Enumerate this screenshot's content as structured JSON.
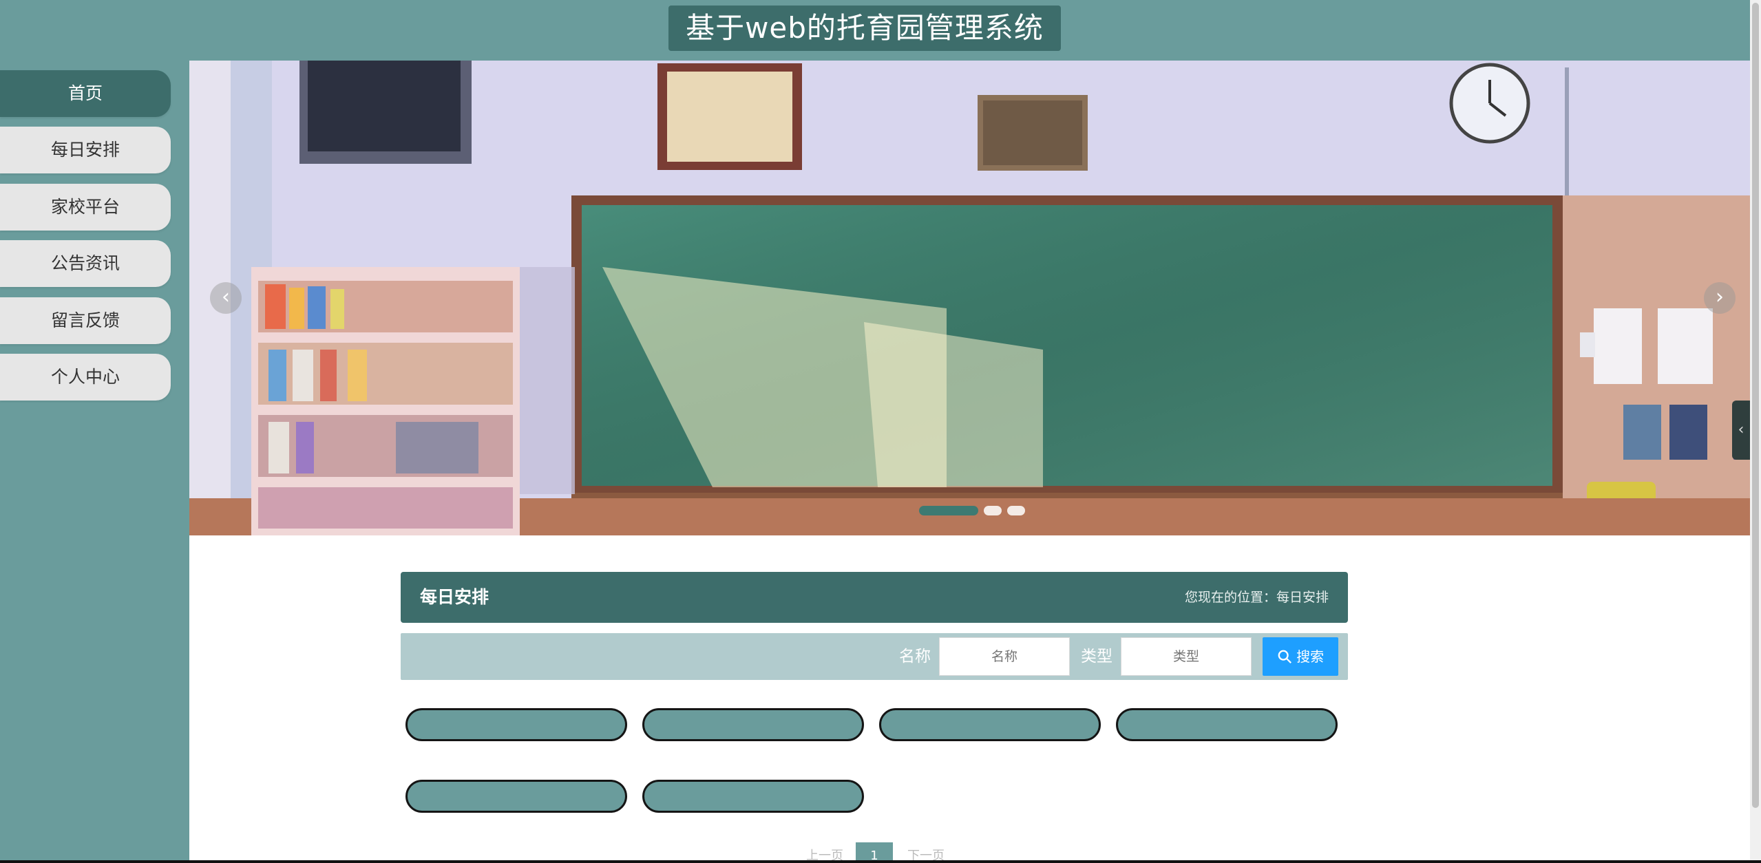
{
  "header": {
    "title": "基于web的托育园管理系统"
  },
  "sidebar": {
    "items": [
      {
        "label": "首页",
        "active": true
      },
      {
        "label": "每日安排",
        "active": false
      },
      {
        "label": "家校平台",
        "active": false
      },
      {
        "label": "公告资讯",
        "active": false
      },
      {
        "label": "留言反馈",
        "active": false
      },
      {
        "label": "个人中心",
        "active": false
      }
    ]
  },
  "banner": {
    "prev_icon": "chevron-left-icon",
    "next_icon": "chevron-right-icon",
    "prev_glyph": "‹",
    "next_glyph": "›",
    "slide_count": 3,
    "active_slide": 1
  },
  "section": {
    "title": "每日安排",
    "breadcrumb": "您现在的位置：每日安排"
  },
  "search": {
    "name_label": "名称",
    "name_placeholder": "名称",
    "type_label": "类型",
    "type_placeholder": "类型",
    "button_label": "搜索",
    "button_icon": "search-icon"
  },
  "items": {
    "count": 6
  },
  "pagination": {
    "prev_label": "上一页",
    "current_page": "1",
    "next_label": "下一页"
  },
  "side_toggle": {
    "icon": "chevron-left-icon",
    "glyph": "‹"
  },
  "colors": {
    "teal": "#6a9c9c",
    "teal_dark": "#3d6d6b",
    "search_bg": "#b1cbcd",
    "button_blue": "#1e9fff"
  }
}
